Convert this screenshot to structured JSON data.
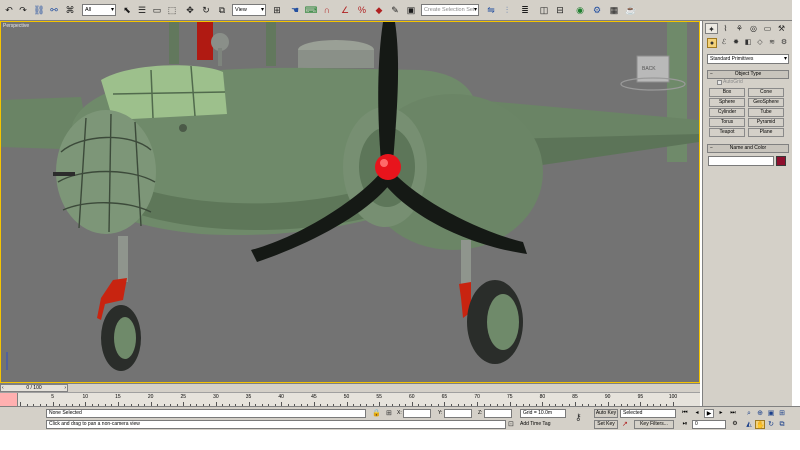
{
  "toolbar": {
    "selection_filter": "All",
    "reference_coord_system": "View",
    "named_selection_set_placeholder": "Create Selection Set",
    "icons": [
      "undo-icon",
      "redo-icon",
      "select-and-link-icon",
      "unlink-icon",
      "bind-space-warp-icon",
      "select-object-icon",
      "select-by-name-icon",
      "rectangular-selection-icon",
      "window-crossing-icon",
      "select-and-move-icon",
      "select-and-rotate-icon",
      "select-and-scale-icon",
      "use-pivot-center-icon",
      "select-and-manipulate-icon",
      "keyboard-shortcut-override-icon",
      "snaps-toggle-icon",
      "angle-snap-icon",
      "percent-snap-icon",
      "spinner-snap-icon",
      "edit-named-selection-icon",
      "mirror-icon",
      "align-icon",
      "layer-manager-icon",
      "curve-editor-icon",
      "schematic-view-icon",
      "material-editor-icon",
      "render-setup-icon",
      "rendered-frame-window-icon",
      "quick-render-icon"
    ]
  },
  "viewport": {
    "label": "Perspective",
    "viewcube_label": "BACK",
    "colors": {
      "background": "#737373",
      "border_active": "#f5c400",
      "fuselage": "#6f8a6a",
      "canopy": "#9dc08c",
      "spinner": "#e8141c",
      "landing_gear": "#c82410",
      "tire": "#2a2d2a",
      "propeller": "#151915"
    }
  },
  "command_panel": {
    "tabs": [
      "create-tab",
      "modify-tab",
      "hierarchy-tab",
      "motion-tab",
      "display-tab",
      "utilities-tab"
    ],
    "categories": [
      "geometry-icon",
      "shapes-icon",
      "lights-icon",
      "cameras-icon",
      "helpers-icon",
      "space-warps-icon",
      "systems-icon"
    ],
    "category_dropdown": "Standard Primitives",
    "object_type_title": "Object Type",
    "autogrid_label": "AutoGrid",
    "primitives": [
      "Box",
      "Cone",
      "Sphere",
      "GeoSphere",
      "Cylinder",
      "Tube",
      "Torus",
      "Pyramid",
      "Teapot",
      "Plane"
    ],
    "name_and_color_title": "Name and Color",
    "object_name": "",
    "object_color": "#8e0f2e"
  },
  "timeline": {
    "time_slider_label": "0 / 100",
    "frames": [
      "0",
      "5",
      "10",
      "15",
      "20",
      "25",
      "30",
      "35",
      "40",
      "45",
      "50",
      "55",
      "60",
      "65",
      "70",
      "75",
      "80",
      "85",
      "90",
      "95",
      "100"
    ]
  },
  "status": {
    "selection_info": "None Selected",
    "prompt": "Click and drag to pan a non-camera view",
    "x_label": "X:",
    "y_label": "Y:",
    "z_label": "Z:",
    "x_value": "",
    "y_value": "",
    "z_value": "",
    "grid": "Grid = 10.0m",
    "add_time_tag": "Add Time Tag",
    "auto_key": "Auto Key",
    "set_key": "Set Key",
    "key_mode_value": "Selected",
    "key_filters": "Key Filters...",
    "current_frame": "0"
  }
}
